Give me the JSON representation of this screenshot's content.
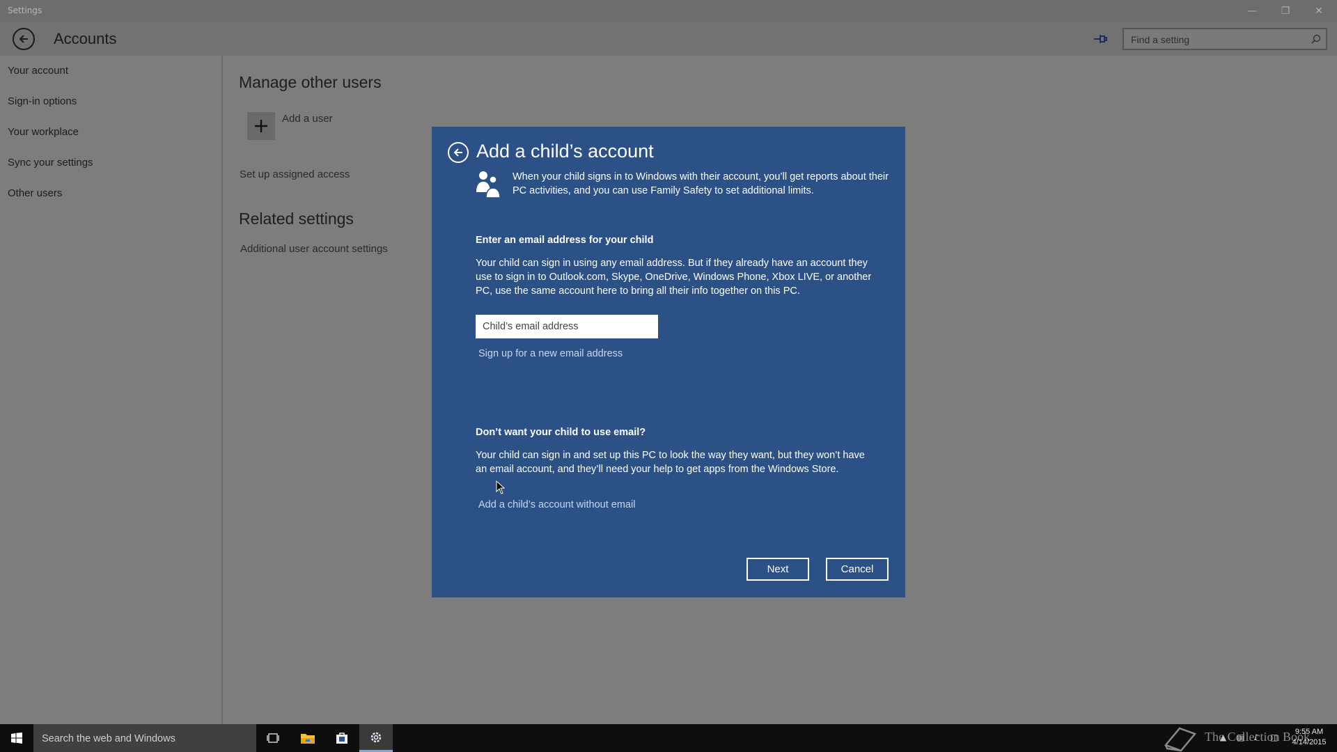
{
  "window": {
    "title": "Settings"
  },
  "header": {
    "page_title": "Accounts",
    "search_placeholder": "Find a setting"
  },
  "nav": {
    "items": [
      "Your account",
      "Sign-in options",
      "Your workplace",
      "Sync your settings",
      "Other users"
    ]
  },
  "main": {
    "manage_heading": "Manage other users",
    "add_user_label": "Add a user",
    "assigned_access_link": "Set up assigned access",
    "related_heading": "Related settings",
    "additional_settings_link": "Additional user account settings"
  },
  "dialog": {
    "title": "Add a child’s account",
    "intro": "When your child signs in to Windows with their account, you’ll get reports about their PC activities, and you can use Family Safety to set additional limits.",
    "email_heading": "Enter an email address for your child",
    "email_description": "Your child can sign in using any email address. But if they already have an account they use to sign in to Outlook.com, Skype, OneDrive, Windows Phone, Xbox LIVE, or another PC, use the same account here to bring all their info together on this PC.",
    "email_placeholder": "Child’s email address",
    "signup_link": "Sign up for a new email address",
    "no_email_heading": "Don’t want your child to use email?",
    "no_email_description": "Your child can sign in and set up this PC to look the way they want, but they won’t have an email account, and they’ll need your help to get apps from the Windows Store.",
    "no_email_link": "Add a child’s account without email",
    "next_label": "Next",
    "cancel_label": "Cancel"
  },
  "taskbar": {
    "search_placeholder": "Search the web and Windows",
    "watermark_text": "The Collection Book",
    "clock_time": "9:55 AM",
    "clock_date": "4/14/2015"
  },
  "colors": {
    "dialog_bg": "#2b5187",
    "backdrop": "#7d7d7d",
    "taskbar": "#0e0e0e"
  },
  "icons": [
    "back-arrow-icon",
    "pin-icon",
    "search-icon",
    "plus-icon",
    "family-icon",
    "windows-logo-icon",
    "task-view-icon",
    "file-explorer-icon",
    "store-icon",
    "settings-gear-icon",
    "book-icon"
  ]
}
